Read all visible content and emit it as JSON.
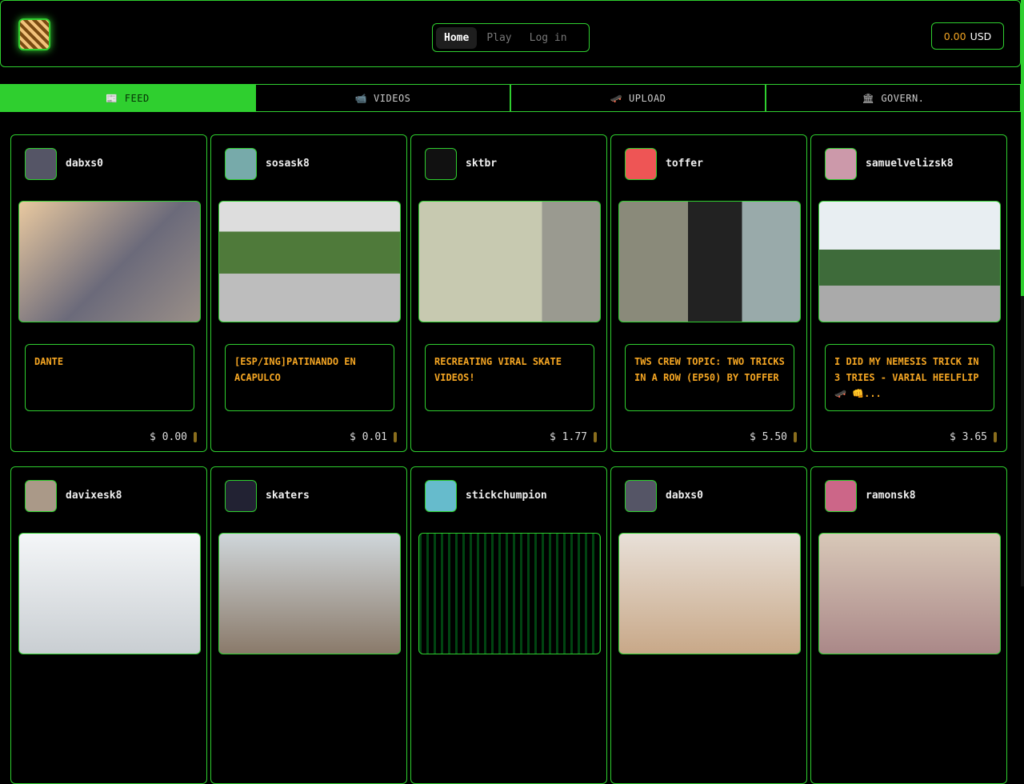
{
  "header": {
    "nav": [
      {
        "label": "Home",
        "active": true
      },
      {
        "label": "Play",
        "active": false
      },
      {
        "label": "Log in",
        "active": false
      }
    ],
    "wallet": {
      "amount": "0.00",
      "currency": "USD"
    }
  },
  "tabs": [
    {
      "label": "FEED",
      "icon": "📰",
      "icon_name": "newspaper-icon",
      "active": true
    },
    {
      "label": "VIDEOS",
      "icon": "📹",
      "icon_name": "video-camera-icon",
      "active": false
    },
    {
      "label": "UPLOAD",
      "icon": "🛹",
      "icon_name": "skateboard-icon",
      "active": false
    },
    {
      "label": "GOVERN.",
      "icon": "🏛",
      "icon_name": "bank-icon",
      "active": false
    }
  ],
  "posts": [
    {
      "author": "dabxs0",
      "title": "DANTE",
      "payout": "$ 0.00",
      "avatar_color": "#556",
      "thumb": "linear-gradient(135deg,#e9c9a0,#6b6a7a 55%,#9a8f88)"
    },
    {
      "author": "sosask8",
      "title": "[ESP/ING]PATINANDO EN ACAPULCO",
      "payout": "$ 0.01",
      "avatar_color": "#7aa",
      "thumb": "linear-gradient(180deg,#ddd 0 25%,#4f7a3a 25% 60%,#bdbdbd 60%)"
    },
    {
      "author": "sktbr",
      "title": "RECREATING VIRAL SKATE VIDEOS!",
      "payout": "$ 1.77",
      "avatar_color": "#111",
      "thumb": "linear-gradient(90deg,#c7c9b0 0 68%,#9a9a90 68%)"
    },
    {
      "author": "toffer",
      "title": "TWS CREW TOPIC: TWO TRICKS IN A ROW (EP50) BY TOFFER",
      "payout": "$ 5.50",
      "avatar_color": "#e55",
      "thumb": "linear-gradient(90deg,#8a8a7a 0 38%,#222 38% 68%,#9aa 68%)"
    },
    {
      "author": "samuelvelizsk8",
      "title": "I DID MY NEMESIS TRICK IN 3 TRIES - VARIAL HEELFLIP 🛹 👊...",
      "payout": "$ 3.65",
      "avatar_color": "#c9a",
      "thumb": "linear-gradient(180deg,#e8eef2 0 40%,#3e6b3a 40% 70%,#aaa 70%)"
    },
    {
      "author": "davixesk8",
      "title": "",
      "payout": "",
      "avatar_color": "#a98",
      "thumb": "linear-gradient(180deg,#f4f6f8,#c9ced2)"
    },
    {
      "author": "skaters",
      "title": "",
      "payout": "",
      "avatar_color": "#223",
      "thumb": "linear-gradient(180deg,#cfd6da,#8a7a6a)"
    },
    {
      "author": "stickchumpion",
      "title": "",
      "payout": "",
      "avatar_color": "#6bc",
      "thumb": "repeating-linear-gradient(90deg,#041 0 3px,#000 3px 9px)"
    },
    {
      "author": "dabxs0",
      "title": "",
      "payout": "",
      "avatar_color": "#556",
      "thumb": "linear-gradient(180deg,#e8e0d8,#c8a888)"
    },
    {
      "author": "ramonsk8",
      "title": "",
      "payout": "",
      "avatar_color": "#c68",
      "thumb": "linear-gradient(180deg,#d8c8b8,#a88)"
    }
  ]
}
